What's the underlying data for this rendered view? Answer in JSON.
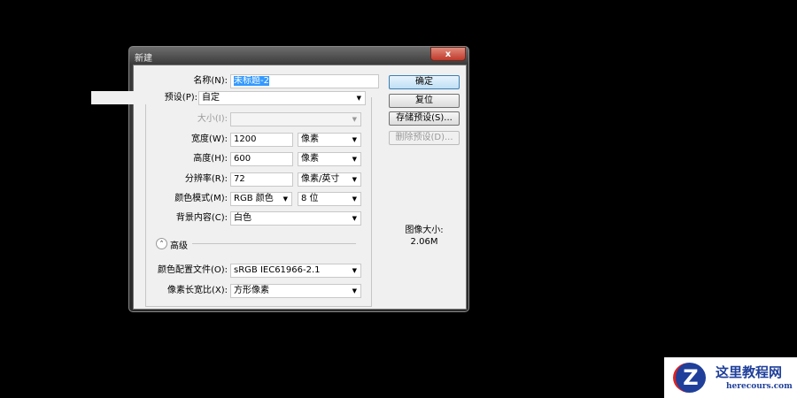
{
  "dialog": {
    "title": "新建",
    "close": "x"
  },
  "fields": {
    "name": {
      "label": "名称(N):",
      "value": "未标题-2"
    },
    "preset": {
      "label": "预设(P):",
      "value": "自定"
    },
    "size": {
      "label": "大小(I):",
      "value": ""
    },
    "width": {
      "label": "宽度(W):",
      "value": "1200",
      "unit": "像素"
    },
    "height": {
      "label": "高度(H):",
      "value": "600",
      "unit": "像素"
    },
    "resolution": {
      "label": "分辨率(R):",
      "value": "72",
      "unit": "像素/英寸"
    },
    "color_mode": {
      "label": "颜色模式(M):",
      "value": "RGB 颜色",
      "depth": "8 位"
    },
    "background": {
      "label": "背景内容(C):",
      "value": "白色"
    },
    "advanced": {
      "label": "高级"
    },
    "profile": {
      "label": "颜色配置文件(O):",
      "value": "sRGB IEC61966-2.1"
    },
    "aspect": {
      "label": "像素长宽比(X):",
      "value": "方形像素"
    }
  },
  "buttons": {
    "ok": "确定",
    "reset": "复位",
    "save_preset": "存储预设(S)...",
    "delete_preset": "删除预设(D)..."
  },
  "image_size": {
    "label": "图像大小:",
    "value": "2.06M"
  },
  "watermark": {
    "name": "这里教程网",
    "url": "herecours.com"
  }
}
